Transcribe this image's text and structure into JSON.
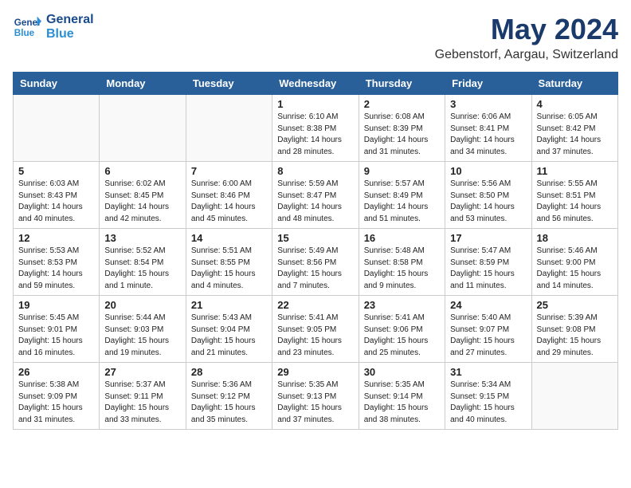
{
  "header": {
    "logo_line1": "General",
    "logo_line2": "Blue",
    "month": "May 2024",
    "location": "Gebenstorf, Aargau, Switzerland"
  },
  "days_of_week": [
    "Sunday",
    "Monday",
    "Tuesday",
    "Wednesday",
    "Thursday",
    "Friday",
    "Saturday"
  ],
  "weeks": [
    [
      {
        "day": "",
        "info": ""
      },
      {
        "day": "",
        "info": ""
      },
      {
        "day": "",
        "info": ""
      },
      {
        "day": "1",
        "info": "Sunrise: 6:10 AM\nSunset: 8:38 PM\nDaylight: 14 hours\nand 28 minutes."
      },
      {
        "day": "2",
        "info": "Sunrise: 6:08 AM\nSunset: 8:39 PM\nDaylight: 14 hours\nand 31 minutes."
      },
      {
        "day": "3",
        "info": "Sunrise: 6:06 AM\nSunset: 8:41 PM\nDaylight: 14 hours\nand 34 minutes."
      },
      {
        "day": "4",
        "info": "Sunrise: 6:05 AM\nSunset: 8:42 PM\nDaylight: 14 hours\nand 37 minutes."
      }
    ],
    [
      {
        "day": "5",
        "info": "Sunrise: 6:03 AM\nSunset: 8:43 PM\nDaylight: 14 hours\nand 40 minutes."
      },
      {
        "day": "6",
        "info": "Sunrise: 6:02 AM\nSunset: 8:45 PM\nDaylight: 14 hours\nand 42 minutes."
      },
      {
        "day": "7",
        "info": "Sunrise: 6:00 AM\nSunset: 8:46 PM\nDaylight: 14 hours\nand 45 minutes."
      },
      {
        "day": "8",
        "info": "Sunrise: 5:59 AM\nSunset: 8:47 PM\nDaylight: 14 hours\nand 48 minutes."
      },
      {
        "day": "9",
        "info": "Sunrise: 5:57 AM\nSunset: 8:49 PM\nDaylight: 14 hours\nand 51 minutes."
      },
      {
        "day": "10",
        "info": "Sunrise: 5:56 AM\nSunset: 8:50 PM\nDaylight: 14 hours\nand 53 minutes."
      },
      {
        "day": "11",
        "info": "Sunrise: 5:55 AM\nSunset: 8:51 PM\nDaylight: 14 hours\nand 56 minutes."
      }
    ],
    [
      {
        "day": "12",
        "info": "Sunrise: 5:53 AM\nSunset: 8:53 PM\nDaylight: 14 hours\nand 59 minutes."
      },
      {
        "day": "13",
        "info": "Sunrise: 5:52 AM\nSunset: 8:54 PM\nDaylight: 15 hours\nand 1 minute."
      },
      {
        "day": "14",
        "info": "Sunrise: 5:51 AM\nSunset: 8:55 PM\nDaylight: 15 hours\nand 4 minutes."
      },
      {
        "day": "15",
        "info": "Sunrise: 5:49 AM\nSunset: 8:56 PM\nDaylight: 15 hours\nand 7 minutes."
      },
      {
        "day": "16",
        "info": "Sunrise: 5:48 AM\nSunset: 8:58 PM\nDaylight: 15 hours\nand 9 minutes."
      },
      {
        "day": "17",
        "info": "Sunrise: 5:47 AM\nSunset: 8:59 PM\nDaylight: 15 hours\nand 11 minutes."
      },
      {
        "day": "18",
        "info": "Sunrise: 5:46 AM\nSunset: 9:00 PM\nDaylight: 15 hours\nand 14 minutes."
      }
    ],
    [
      {
        "day": "19",
        "info": "Sunrise: 5:45 AM\nSunset: 9:01 PM\nDaylight: 15 hours\nand 16 minutes."
      },
      {
        "day": "20",
        "info": "Sunrise: 5:44 AM\nSunset: 9:03 PM\nDaylight: 15 hours\nand 19 minutes."
      },
      {
        "day": "21",
        "info": "Sunrise: 5:43 AM\nSunset: 9:04 PM\nDaylight: 15 hours\nand 21 minutes."
      },
      {
        "day": "22",
        "info": "Sunrise: 5:41 AM\nSunset: 9:05 PM\nDaylight: 15 hours\nand 23 minutes."
      },
      {
        "day": "23",
        "info": "Sunrise: 5:41 AM\nSunset: 9:06 PM\nDaylight: 15 hours\nand 25 minutes."
      },
      {
        "day": "24",
        "info": "Sunrise: 5:40 AM\nSunset: 9:07 PM\nDaylight: 15 hours\nand 27 minutes."
      },
      {
        "day": "25",
        "info": "Sunrise: 5:39 AM\nSunset: 9:08 PM\nDaylight: 15 hours\nand 29 minutes."
      }
    ],
    [
      {
        "day": "26",
        "info": "Sunrise: 5:38 AM\nSunset: 9:09 PM\nDaylight: 15 hours\nand 31 minutes."
      },
      {
        "day": "27",
        "info": "Sunrise: 5:37 AM\nSunset: 9:11 PM\nDaylight: 15 hours\nand 33 minutes."
      },
      {
        "day": "28",
        "info": "Sunrise: 5:36 AM\nSunset: 9:12 PM\nDaylight: 15 hours\nand 35 minutes."
      },
      {
        "day": "29",
        "info": "Sunrise: 5:35 AM\nSunset: 9:13 PM\nDaylight: 15 hours\nand 37 minutes."
      },
      {
        "day": "30",
        "info": "Sunrise: 5:35 AM\nSunset: 9:14 PM\nDaylight: 15 hours\nand 38 minutes."
      },
      {
        "day": "31",
        "info": "Sunrise: 5:34 AM\nSunset: 9:15 PM\nDaylight: 15 hours\nand 40 minutes."
      },
      {
        "day": "",
        "info": ""
      }
    ]
  ]
}
